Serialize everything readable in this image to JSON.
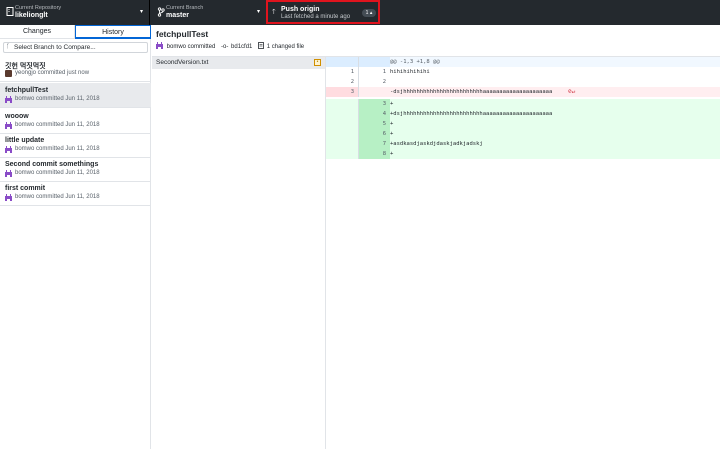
{
  "topbar": {
    "repo_label": "Current Repository",
    "repo_value": "likelionglt",
    "branch_label": "Current Branch",
    "branch_value": "master",
    "push_title": "Push origin",
    "push_sub": "Last fetched a minute ago",
    "push_badge": "1 ▴",
    "push_icon": "arrow-up-icon",
    "highlight_color": "#e0141e"
  },
  "sidebar": {
    "tabs": {
      "changes": "Changes",
      "history": "History"
    },
    "compare_placeholder": "Select Branch to Compare...",
    "commits": [
      {
        "title": "깃헌 먹짓먹짓",
        "meta": "yeongjo committed just now"
      },
      {
        "title": "fetchpullTest",
        "meta": "bomwo committed Jun 11, 2018"
      },
      {
        "title": "wooow",
        "meta": "bomwo committed Jun 11, 2018"
      },
      {
        "title": "little update",
        "meta": "bomwo committed Jun 11, 2018"
      },
      {
        "title": "Second commit somethings",
        "meta": "bomwo committed Jun 11, 2018"
      },
      {
        "title": "first commit",
        "meta": "bomwo committed Jun 11, 2018"
      }
    ]
  },
  "main": {
    "title": "fetchpullTest",
    "author": "bomwo committed",
    "sha": "bd1cfd1",
    "files_changed": "1 changed file",
    "file_name": "SecondVersion.txt",
    "file_badge": "•"
  },
  "diff": {
    "hunk": "@@ -1,3 +1,8 @@",
    "lines": [
      {
        "old": "1",
        "new": "1",
        "text": " hihihihihihi"
      },
      {
        "old": "2",
        "new": "2",
        "text": ""
      },
      {
        "old": "3",
        "new": "",
        "text": "-dsjhhhhhhhhhhhhhhhhhhhhhhhhaaaaaaaaaaaaaaaaaaaaa"
      },
      {
        "old": "",
        "new": "3",
        "text": "+"
      },
      {
        "old": "",
        "new": "4",
        "text": "+dsjhhhhhhhhhhhhhhhhhhhhhhhhaaaaaaaaaaaaaaaaaaaaa"
      },
      {
        "old": "",
        "new": "5",
        "text": "+"
      },
      {
        "old": "",
        "new": "6",
        "text": "+"
      },
      {
        "old": "",
        "new": "7",
        "text": "+asdkasdjaskdjdaskjadkjadskj"
      },
      {
        "old": "",
        "new": "8",
        "text": "+"
      }
    ]
  }
}
